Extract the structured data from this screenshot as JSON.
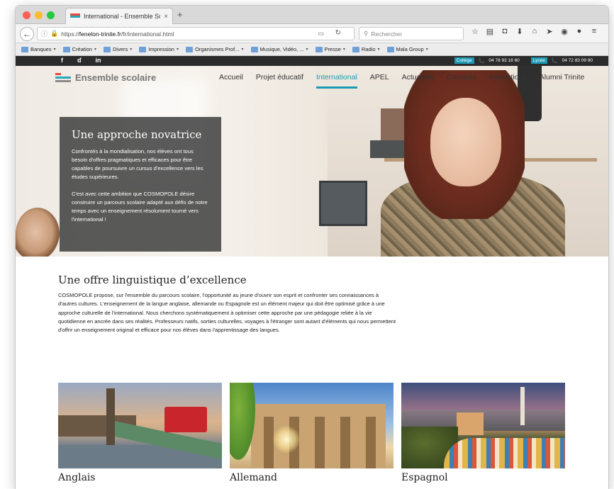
{
  "browser": {
    "tab_title": "International - Ensemble Sc...",
    "tab_close": "×",
    "new_tab": "+",
    "url_prefix": "https://",
    "url_host": "fenelon-trinite.fr",
    "url_path": "/fr/international.html",
    "search_placeholder": "Rechercher",
    "bookmarks": [
      {
        "label": "Banques",
        "dropdown": true
      },
      {
        "label": "Création",
        "dropdown": true
      },
      {
        "label": "Divers",
        "dropdown": true
      },
      {
        "label": "Impression",
        "dropdown": true
      },
      {
        "label": "Organismes Prof...",
        "dropdown": true
      },
      {
        "label": "Musique, Vidéo, ...",
        "dropdown": true
      },
      {
        "label": "Presse",
        "dropdown": true
      },
      {
        "label": "Radio",
        "dropdown": true
      },
      {
        "label": "Mala Group",
        "dropdown": true
      }
    ],
    "colors": {
      "close": "#fc5f57",
      "minimize": "#fdbc2e",
      "maximize": "#28c840"
    }
  },
  "topbar": {
    "social": [
      "f",
      "ɗ",
      "in"
    ],
    "college_label": "Collège",
    "college_phone": "04 78 93 18 60",
    "lycee_label": "Lycée",
    "lycee_phone": "04 72 83 09 90"
  },
  "site": {
    "logo_text": "Ensemble scolaire",
    "menu": [
      "Accueil",
      "Projet éducatif",
      "International",
      "APEL",
      "Actualités",
      "Contacts",
      "Inscriptions",
      "Alumni Trinite"
    ],
    "active_menu": "International",
    "accent_color": "#1d9ab3"
  },
  "hero": {
    "title": "Une approche novatrice",
    "paragraph1": "Confrontés à la mondialisation, nos élèves ont tous besoin d'offres pragmatiques et efficaces pour être capables de poursuivre un cursus d'excellence vers les études supérieures.",
    "paragraph2": "C'est avec cette ambition que COSMOPOLE désire construire un parcours scolaire adapté aux défis de notre temps avec un enseignement résolument tourné vers l'international !"
  },
  "content": {
    "title": "Une offre linguistique d’excellence",
    "body": "COSMOPOLE propose, sur l'ensemble du parcours scolaire, l'opportunité au jeune d'ouvrir son esprit et confronter ses connaissances à d'autres cultures. L'enseignement de la langue anglaise, allemande ou Espagnole est un élément majeur qui doit être optimisé grâce à une approche culturelle de l'international. Nous cherchons systématiquement à optimiser cette approche par une pédagogie reliée à la vie quotidienne en ancrée dans ses réalités. Professeurs natifs, sorties culturelles, voyages à l'étranger sont autant d'éléments qui nous permettent d'offrir un enseignement original et efficace pour nos élèves dans l'apprentissage des langues."
  },
  "cards": [
    {
      "label": "Anglais"
    },
    {
      "label": "Allemand"
    },
    {
      "label": "Espagnol"
    }
  ]
}
